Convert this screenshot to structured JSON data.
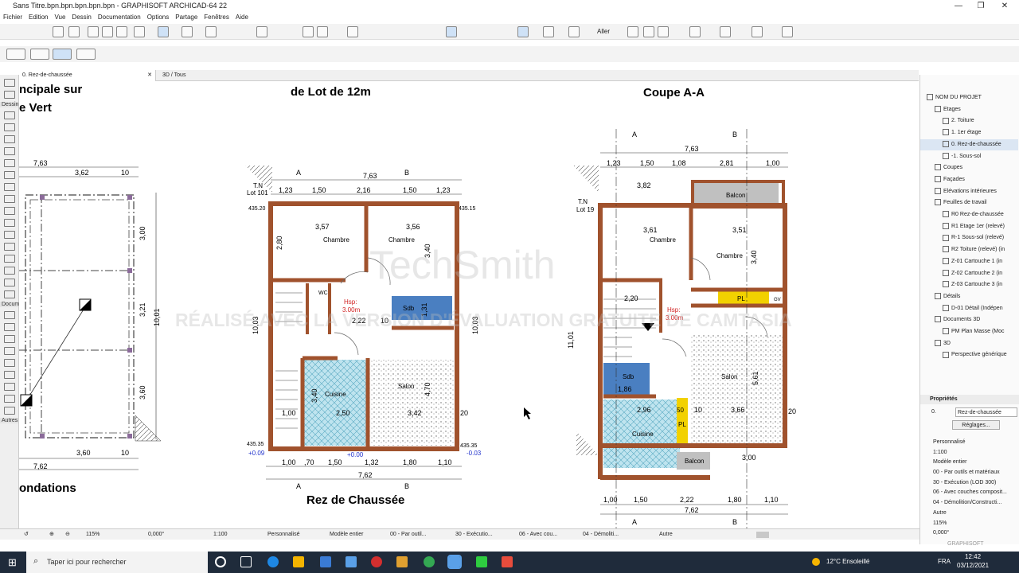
{
  "title": "Sans Titre.bpn.bpn.bpn.bpn.bpn - GRAPHISOFT ARCHICAD-64 22",
  "menu": [
    "Fichier",
    "Edition",
    "Vue",
    "Dessin",
    "Documentation",
    "Options",
    "Partage",
    "Fenêtres",
    "Aide"
  ],
  "toolbar": {
    "aller": "Aller"
  },
  "left_tools": {
    "dessin": "Dessin",
    "docum": "Docum",
    "autres": "Autres"
  },
  "tabs": {
    "plan": "0. Rez-de-chaussée",
    "view3d": "3D / Tous"
  },
  "watermark": {
    "line1": "TechSmith",
    "line2": "RÉALISÉ AVEC LA VERSION D'ÉVALUATION GRATUITE DE CAMTASIA"
  },
  "drawing": {
    "left_title_1": "ncipale sur",
    "left_title_2": "e Vert",
    "left_bottom": "ondations",
    "left_dims": [
      "7,63",
      "3,62",
      "10",
      "3,00",
      "3,21",
      "10,01",
      "3,60",
      "7,62",
      "3,60",
      "10"
    ],
    "mid_title": "de Lot de 12m",
    "mid_caption": "Rez de Chaussée",
    "mid_top_dims": [
      "1,23",
      "1,50",
      "2,16",
      "1,50",
      "1,23"
    ],
    "mid_total": "7,63",
    "mid_bottom_dims": [
      "1,00",
      ",70",
      "1,50",
      "1,32",
      "1,80",
      "1,10"
    ],
    "mid_bottom_total": "7,62",
    "mid_rooms": [
      "Chambre",
      "Chambre",
      "WC",
      "Sdb",
      "Cuisine",
      "Salon"
    ],
    "mid_labels": [
      "Hsp:",
      "3.00m",
      "T.N",
      "Lot 101",
      "A",
      "B",
      "+0.00",
      "+0.09",
      "-0.03",
      "435.20",
      "435.15",
      "435.35",
      "435.35"
    ],
    "mid_inner": [
      "3,57",
      "3,56",
      "2,22",
      "10",
      "20",
      "20",
      "2,80",
      "3,40",
      "4,70",
      "3,40",
      "1,00",
      "2,50",
      "3,42",
      "10,03",
      "10,03",
      "1,31",
      "20"
    ],
    "right_title": "Coupe A-A",
    "right_top_dims": [
      "1,23",
      "1,50",
      "1,08",
      "2,81",
      "1,00"
    ],
    "right_total": "7,63",
    "right_bottom_dims": [
      "1,00",
      "1,50",
      "2,22",
      "1,80",
      "1,10"
    ],
    "right_bottom_total": "7,62",
    "right_rooms": [
      "Balcon",
      "Chambre",
      "Chambre",
      "Sdb",
      "Cuisine",
      "Salon",
      "Balcon",
      "PL",
      "PL",
      "GV"
    ],
    "right_labels": [
      "Hsp:",
      "3.00m",
      "T.N",
      "Lot 19",
      "A",
      "B"
    ],
    "right_inner": [
      "3,82",
      "3,61",
      "3,51",
      "2,20",
      "3,40",
      "1,86",
      "2,96",
      "3,66",
      "5,61",
      "11,01",
      "3,00",
      "50",
      "20",
      "10"
    ]
  },
  "status": {
    "zoom": "115%",
    "angle": "0,000°",
    "scale": "1:100",
    "perso": "Personnalisé",
    "modele": "Modèle entier",
    "par_outil": "00 - Par outil...",
    "execution": "30 - Exécutio...",
    "avec_cou": "06 - Avec cou...",
    "demoli": "04 - Démoliti...",
    "autre": "Autre"
  },
  "navigator": [
    {
      "label": "NOM DU PROJET",
      "level": 0
    },
    {
      "label": "Etages",
      "level": 1
    },
    {
      "label": "2. Toiture",
      "level": 2
    },
    {
      "label": "1. 1er étage",
      "level": 2
    },
    {
      "label": "0. Rez-de-chaussée",
      "level": 2,
      "selected": true
    },
    {
      "label": "-1. Sous-sol",
      "level": 2
    },
    {
      "label": "Coupes",
      "level": 1
    },
    {
      "label": "Façades",
      "level": 1
    },
    {
      "label": "Elévations intérieures",
      "level": 1
    },
    {
      "label": "Feuilles de travail",
      "level": 1
    },
    {
      "label": "R0 Rez-de-chaussée",
      "level": 2
    },
    {
      "label": "R1 Etage 1er (relevé)",
      "level": 2
    },
    {
      "label": "R-1 Sous-sol (relevé)",
      "level": 2
    },
    {
      "label": "R2 Toiture (relevé) (in",
      "level": 2
    },
    {
      "label": "Z-01 Cartouche 1 (in",
      "level": 2
    },
    {
      "label": "Z-02 Cartouche 2 (in",
      "level": 2
    },
    {
      "label": "Z-03 Cartouche 3 (in",
      "level": 2
    },
    {
      "label": "Détails",
      "level": 1
    },
    {
      "label": "D-01 Détail (Indépen",
      "level": 2
    },
    {
      "label": "Documents 3D",
      "level": 1
    },
    {
      "label": "PM Plan Masse (Moc",
      "level": 2
    },
    {
      "label": "3D",
      "level": 1
    },
    {
      "label": "Perspective générique",
      "level": 2
    }
  ],
  "properties": {
    "header": "Propriétés",
    "id": "0.",
    "name": "Rez-de-chaussée",
    "reglages": "Réglages...",
    "rows": [
      "Personnalisé",
      "1:100",
      "Modèle entier",
      "00 - Par outils et matériaux",
      "30 - Exécution (LOD 300)",
      "06 - Avec couches composit...",
      "04 - Démolition/Constructi...",
      "Autre",
      "115%",
      "0,000°"
    ],
    "brand": "GRAPHISOFT"
  },
  "taskbar": {
    "search_placeholder": "Taper ici pour rechercher",
    "weather": "12°C Ensoleillé",
    "lang": "FRA",
    "time": "12:42",
    "date": "03/12/2021"
  },
  "colors": {
    "wall": "#a0522d",
    "tile": "#a9d9e8",
    "sdb": "#4a7fc1",
    "balcon": "#c0c0c0",
    "pl": "#f2d100",
    "accent": "#0b6bd3"
  }
}
